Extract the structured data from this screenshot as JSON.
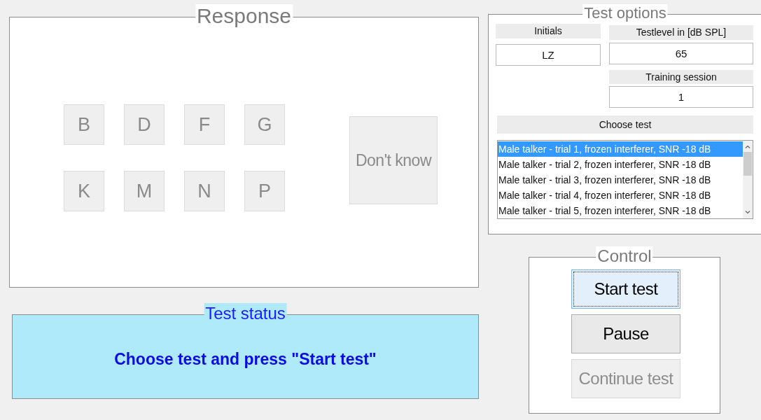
{
  "response": {
    "title": "Response",
    "letter_buttons": [
      {
        "label": "B",
        "disabled": true
      },
      {
        "label": "D",
        "disabled": true
      },
      {
        "label": "F",
        "disabled": true
      },
      {
        "label": "G",
        "disabled": true
      },
      {
        "label": "K",
        "disabled": true
      },
      {
        "label": "M",
        "disabled": true
      },
      {
        "label": "N",
        "disabled": true
      },
      {
        "label": "P",
        "disabled": true
      }
    ],
    "dont_know": {
      "label": "Don't know",
      "disabled": true
    }
  },
  "test_status": {
    "title": "Test status",
    "message": "Choose test and press \"Start test\""
  },
  "test_options": {
    "title": "Test options",
    "initials": {
      "label": "Initials",
      "value": "LZ"
    },
    "testlevel": {
      "label": "Testlevel in [dB SPL]",
      "value": "65"
    },
    "training_session": {
      "label": "Training session",
      "value": "1"
    },
    "choose_test": {
      "label": "Choose test",
      "items": [
        {
          "text": "Male talker - trial 1, frozen interferer, SNR -18 dB",
          "selected": true
        },
        {
          "text": "Male talker - trial 2, frozen interferer, SNR -18 dB",
          "selected": false
        },
        {
          "text": "Male talker - trial 3, frozen interferer, SNR -18 dB",
          "selected": false
        },
        {
          "text": "Male talker - trial 4, frozen interferer, SNR -18 dB",
          "selected": false
        },
        {
          "text": "Male talker - trial 5, frozen interferer, SNR -18 dB",
          "selected": false
        }
      ]
    }
  },
  "control": {
    "title": "Control",
    "buttons": [
      {
        "label": "Start test",
        "focused": true,
        "disabled": false
      },
      {
        "label": "Pause",
        "focused": false,
        "disabled": false
      },
      {
        "label": "Continue test",
        "focused": false,
        "disabled": true
      }
    ]
  }
}
